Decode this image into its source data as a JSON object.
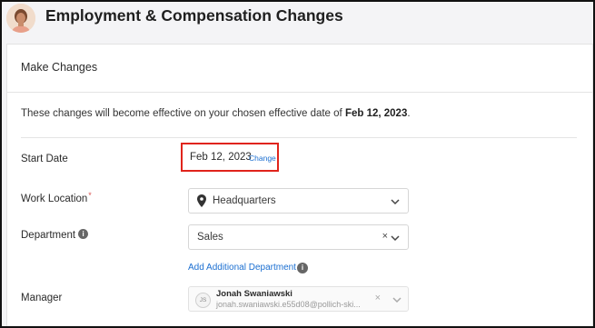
{
  "header": {
    "title": "Employment & Compensation Changes"
  },
  "card": {
    "title": "Make Changes",
    "notice_prefix": "These changes will become effective on your chosen effective date of ",
    "notice_date": "Feb 12, 2023",
    "notice_suffix": "."
  },
  "fields": {
    "start_date": {
      "label": "Start Date",
      "value": "Feb 12, 2023",
      "change_label": "Change"
    },
    "work_location": {
      "label": "Work Location",
      "required_mark": "*",
      "value": "Headquarters"
    },
    "department": {
      "label": "Department",
      "info_glyph": "i",
      "value": "Sales",
      "clear_glyph": "×",
      "add_label": "Add Additional Department",
      "add_info_glyph": "i"
    },
    "manager": {
      "label": "Manager",
      "initials": "JS",
      "name": "Jonah Swaniawski",
      "email": "jonah.swaniawski.e55d08@pollich-ski...",
      "clear_glyph": "×"
    }
  },
  "colors": {
    "link": "#1b6fd1",
    "highlight_box": "#e0241b",
    "required": "#d9534f"
  }
}
